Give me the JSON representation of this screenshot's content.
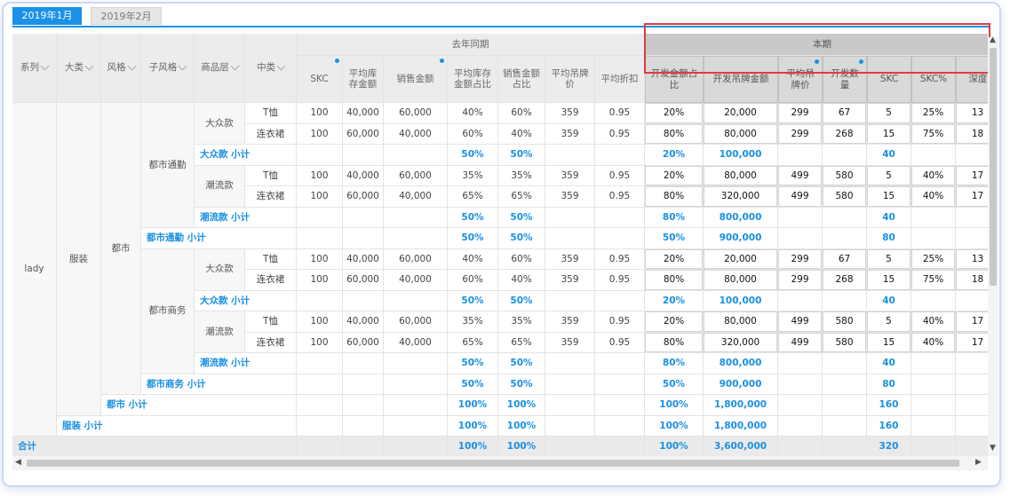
{
  "tabs": [
    {
      "label": "2019年1月",
      "active": true
    },
    {
      "label": "2019年2月",
      "active": false
    }
  ],
  "dim_headers": [
    "系列",
    "大类",
    "风格",
    "子风格",
    "商品层",
    "中类"
  ],
  "group_headers": {
    "last_year": "去年同期",
    "current": "本期"
  },
  "measure_headers": [
    "SKC",
    "平均库存金额",
    "销售金额",
    "平均库存金额占比",
    "销售金额占比",
    "平均吊牌价",
    "平均折扣",
    "开发金额占比",
    "开发吊牌金额",
    "平均吊牌价",
    "开发数量",
    "SKC",
    "SKC%",
    "深度"
  ],
  "dims": {
    "series": "lady",
    "category": "服装",
    "style": "都市",
    "substyles": [
      "都市通勤",
      "都市商务"
    ],
    "layers": [
      "大众款",
      "潮流款"
    ]
  },
  "rows": [
    {
      "type": "data",
      "cls": "T恤",
      "v": [
        "100",
        "40,000",
        "60,000",
        "40%",
        "60%",
        "359",
        "0.95",
        "20%",
        "20,000",
        "299",
        "67",
        "5",
        "25%",
        "13"
      ]
    },
    {
      "type": "data",
      "cls": "连衣裙",
      "v": [
        "100",
        "60,000",
        "40,000",
        "60%",
        "40%",
        "359",
        "0.95",
        "80%",
        "80,000",
        "299",
        "268",
        "15",
        "75%",
        "18"
      ]
    },
    {
      "type": "sub1",
      "label": "大众款 小计",
      "v": [
        "50%",
        "50%",
        "20%",
        "100,000",
        "40"
      ]
    },
    {
      "type": "data",
      "cls": "T恤",
      "v": [
        "100",
        "40,000",
        "60,000",
        "35%",
        "35%",
        "359",
        "0.95",
        "20%",
        "80,000",
        "499",
        "580",
        "5",
        "40%",
        "17"
      ]
    },
    {
      "type": "data",
      "cls": "连衣裙",
      "v": [
        "100",
        "60,000",
        "40,000",
        "65%",
        "65%",
        "359",
        "0.95",
        "80%",
        "320,000",
        "499",
        "580",
        "15",
        "40%",
        "17"
      ]
    },
    {
      "type": "sub1",
      "label": "潮流款 小计",
      "v": [
        "50%",
        "50%",
        "80%",
        "800,000",
        "40"
      ]
    },
    {
      "type": "sub2",
      "label": "都市通勤 小计",
      "v": [
        "50%",
        "50%",
        "50%",
        "900,000",
        "80"
      ]
    },
    {
      "type": "data",
      "cls": "T恤",
      "v": [
        "100",
        "40,000",
        "60,000",
        "40%",
        "60%",
        "359",
        "0.95",
        "20%",
        "20,000",
        "299",
        "67",
        "5",
        "25%",
        "13"
      ]
    },
    {
      "type": "data",
      "cls": "连衣裙",
      "v": [
        "100",
        "60,000",
        "40,000",
        "60%",
        "40%",
        "359",
        "0.95",
        "80%",
        "80,000",
        "299",
        "268",
        "15",
        "75%",
        "18"
      ]
    },
    {
      "type": "sub1",
      "label": "大众款 小计",
      "v": [
        "50%",
        "50%",
        "20%",
        "100,000",
        "40"
      ]
    },
    {
      "type": "data",
      "cls": "T恤",
      "v": [
        "100",
        "40,000",
        "60,000",
        "35%",
        "35%",
        "359",
        "0.95",
        "20%",
        "80,000",
        "499",
        "580",
        "5",
        "40%",
        "17"
      ]
    },
    {
      "type": "data",
      "cls": "连衣裙",
      "v": [
        "100",
        "60,000",
        "40,000",
        "65%",
        "65%",
        "359",
        "0.95",
        "80%",
        "320,000",
        "499",
        "580",
        "15",
        "40%",
        "17"
      ]
    },
    {
      "type": "sub1",
      "label": "潮流款 小计",
      "v": [
        "50%",
        "50%",
        "80%",
        "800,000",
        "40"
      ]
    },
    {
      "type": "sub2",
      "label": "都市商务 小计",
      "v": [
        "50%",
        "50%",
        "50%",
        "900,000",
        "80"
      ]
    },
    {
      "type": "sub3",
      "label": "都市 小计",
      "v": [
        "100%",
        "100%",
        "100%",
        "1,800,000",
        "160"
      ]
    },
    {
      "type": "sub4",
      "label": "服装 小计",
      "v": [
        "100%",
        "100%",
        "100%",
        "1,800,000",
        "160"
      ]
    },
    {
      "type": "total",
      "label": "合计",
      "v": [
        "100%",
        "100%",
        "100%",
        "3,600,000",
        "320"
      ]
    }
  ],
  "colors": {
    "accent": "#1a90e8",
    "highlight_border": "#e03b3b"
  }
}
